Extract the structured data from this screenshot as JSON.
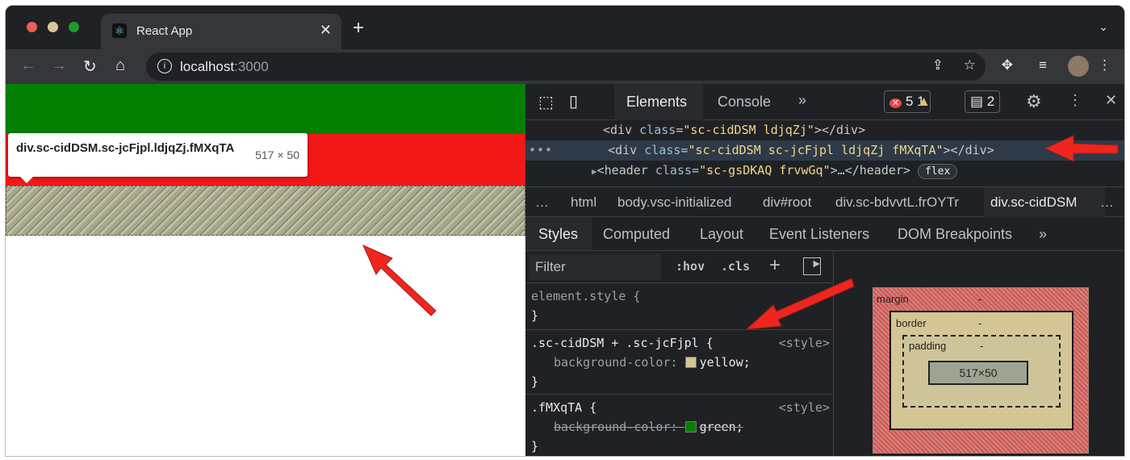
{
  "browser": {
    "tab_title": "React App",
    "url_host": "localhost",
    "url_port": ":3000"
  },
  "tooltip": {
    "selector": "div.sc-cidDSM.sc-jcFjpl.ldjqZj.fMXqTA",
    "size": "517 × 50"
  },
  "devtools": {
    "tabs": [
      "Elements",
      "Console"
    ],
    "errors": "5",
    "warnings": "1",
    "messages": "2",
    "dom_rows": [
      {
        "tag_open": "<div ",
        "attr": "class",
        "val": "\"sc-cidDSM ldjqZj\"",
        "tag_close": "></div>"
      },
      {
        "tag_open": "<div ",
        "attr": "class",
        "val": "\"sc-cidDSM sc-jcFjpl ldjqZj fMXqTA\"",
        "tag_close": "></div>"
      },
      {
        "tag_open": "<header ",
        "attr": "class",
        "val": "\"sc-gsDKAQ frvwGq\"",
        "tag_close": ">…</header>",
        "badge": "flex"
      }
    ],
    "breadcrumbs": [
      "html",
      "body.vsc-initialized",
      "div#root",
      "div.sc-bdvvtL.frOYTr",
      "div.sc-cidDSM"
    ],
    "style_tabs": [
      "Styles",
      "Computed",
      "Layout",
      "Event Listeners",
      "DOM Breakpoints"
    ],
    "filter_placeholder": "Filter",
    "hov": ":hov",
    "cls": ".cls",
    "rules": [
      {
        "selector": "element.style {",
        "close": "}"
      },
      {
        "selector": ".sc-cidDSM + .sc-jcFjpl {",
        "source": "<style>",
        "prop": "background-color:",
        "value": "yellow;",
        "swatch": "#d4c595",
        "close": "}"
      },
      {
        "selector": ".fMXqTA {",
        "source": "<style>",
        "prop": "background-color:",
        "value": "green;",
        "swatch": "#038003",
        "close": "}"
      }
    ],
    "box_model": {
      "margin": "margin",
      "border": "border",
      "padding": "padding",
      "content": "517×50",
      "dash": "-"
    }
  }
}
